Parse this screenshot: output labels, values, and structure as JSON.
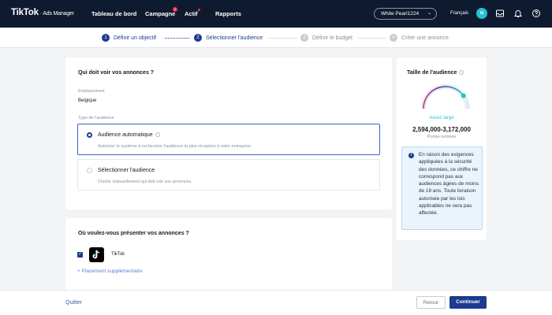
{
  "brand": {
    "logo": "TikTok",
    "logo_sub": "· Ads Manager"
  },
  "nav": [
    {
      "label": "Tableau de bord",
      "badge": ""
    },
    {
      "label": "Campagne",
      "badge": "1"
    },
    {
      "label": "Actif",
      "badge": ""
    },
    {
      "label": "Rapports",
      "badge": ""
    }
  ],
  "account": {
    "name": "White Pearl1224"
  },
  "language": "Français",
  "user_initial": "u",
  "steps": [
    {
      "num": "1",
      "label": "Définir un objectif"
    },
    {
      "num": "2",
      "label": "Sélectionner l'audience"
    },
    {
      "num": "3",
      "label": "Définir le budget"
    },
    {
      "num": "4",
      "label": "Créer une annonce"
    }
  ],
  "audience_section": {
    "title": "Qui doit voir vos annonces ?",
    "location_label": "Emplacement",
    "location_value": "Belgique",
    "type_label": "Type de l'audience",
    "options": [
      {
        "title": "Audience automatique",
        "desc": "Autoriser le système à rechercher l'audience la plus réceptive à votre entreprise."
      },
      {
        "title": "Sélectionner l'audience",
        "desc": "Choisir manuellement qui doit voir vos annonces."
      }
    ]
  },
  "placement_section": {
    "title": "Où voulez-vous présenter vos annonces ?",
    "placement": "TikTok",
    "extra_link": "+ Placement supplémentaire"
  },
  "audience_size": {
    "title": "Taille de l'audience",
    "status": "Assez large",
    "range": "2,594,000-3,172,000",
    "sub": "Portée estimée",
    "gauge_level": 0.8,
    "notice": "En raison des exigences appliquées à la sécurité des données, ce chiffre ne correspond pas aux audiences âgées de moins de 18 ans. Toute livraison autorisée par les lois applicables ne sera pas affectée."
  },
  "footer": {
    "quit": "Quitter",
    "back": "Retour",
    "next": "Continuer"
  },
  "colors": {
    "nav_bg": "#0e1a2f",
    "primary": "#1a3b8f",
    "accent": "#25c2cf",
    "badge": "#fe2c55",
    "page_bg": "#f2f3f5"
  }
}
